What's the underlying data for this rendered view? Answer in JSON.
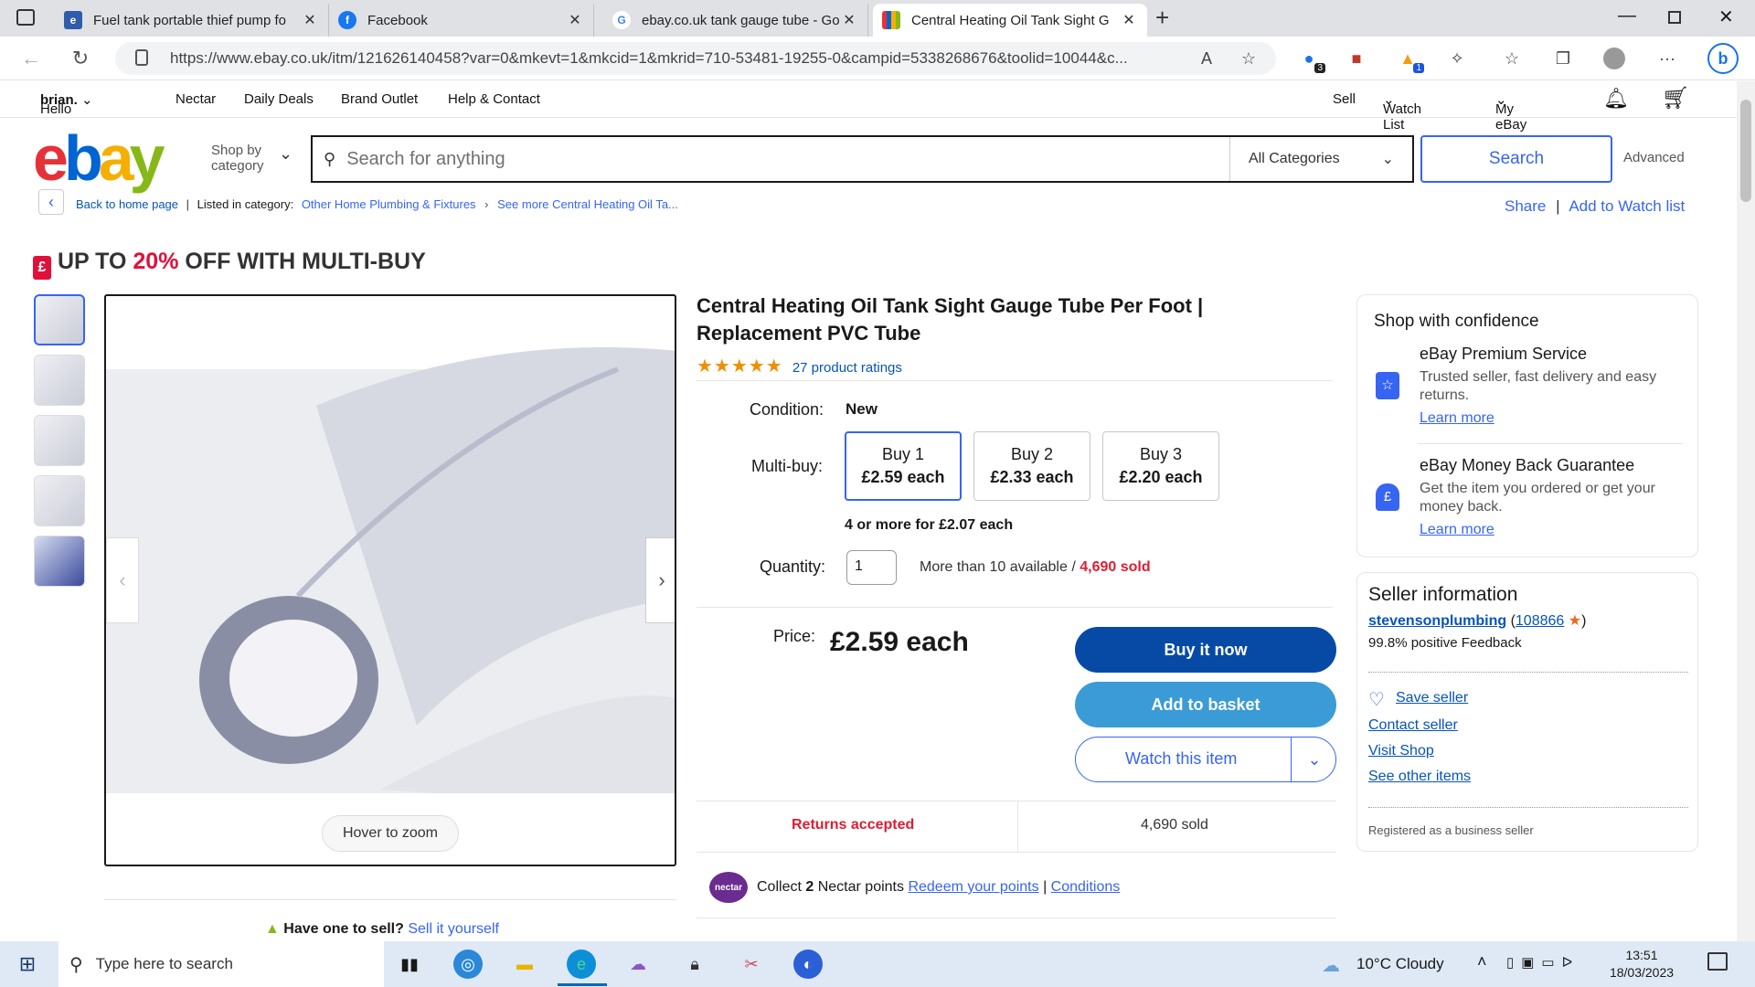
{
  "browser": {
    "tabs": [
      {
        "title": "Fuel tank portable thief pump fo",
        "icon": "ebay-favicon"
      },
      {
        "title": "Facebook",
        "icon": "facebook-favicon"
      },
      {
        "title": "ebay.co.uk tank gauge tube - Go",
        "icon": "google-favicon"
      },
      {
        "title": "Central Heating Oil Tank Sight G",
        "icon": "ebay-favicon"
      }
    ],
    "url": "https://www.ebay.co.uk/itm/121626140458?var=0&mkevt=1&mkcid=1&mkrid=710-53481-19255-0&campid=5338268676&toolid=10044&c...",
    "url_domain": "www.ebay.co.uk",
    "ext_badge_1": "3",
    "ext_badge_2": "1"
  },
  "nav": {
    "greeting": "Hello",
    "user": "brian.",
    "items": [
      "Nectar",
      "Daily Deals",
      "Brand Outlet",
      "Help & Contact"
    ],
    "sell": "Sell",
    "watchlist": "Watch List",
    "myebay": "My eBay"
  },
  "search": {
    "shop_by_1": "Shop by",
    "shop_by_2": "category",
    "placeholder": "Search for anything",
    "category": "All Categories",
    "button": "Search",
    "advanced": "Advanced"
  },
  "breadcrumb": {
    "back": "Back to home page",
    "listed_in": "Listed in category:",
    "cat1": "Other Home Plumbing & Fixtures",
    "cat2": "See more Central Heating Oil Ta...",
    "share": "Share",
    "add_watch": "Add to Watch list"
  },
  "promo": {
    "pre": "UP TO",
    "pct": "20%",
    "post": "OFF WITH MULTI-BUY"
  },
  "gallery": {
    "hover_zoom": "Hover to zoom"
  },
  "product": {
    "title_1": "Central Heating Oil Tank Sight Gauge Tube Per Foot |",
    "title_2": "Replacement PVC Tube",
    "ratings": "27 product ratings",
    "stars": 5,
    "condition_label": "Condition:",
    "condition": "New",
    "multibuy_label": "Multi-buy:",
    "multibuy": [
      {
        "qty": "Buy 1",
        "price": "£2.59 each"
      },
      {
        "qty": "Buy 2",
        "price": "£2.33 each"
      },
      {
        "qty": "Buy 3",
        "price": "£2.20 each"
      }
    ],
    "more_for": "4 or more for £2.07 each",
    "quantity_label": "Quantity:",
    "quantity": "1",
    "available": "More than 10 available /",
    "sold": "4,690 sold",
    "price_label": "Price:",
    "price": "£2.59 each",
    "buy_now": "Buy it now",
    "add_basket": "Add to basket",
    "watch": "Watch this item",
    "returns": "Returns accepted",
    "sold_count": "4,690 sold",
    "nectar_badge": "nectar",
    "nectar_pre": "Collect",
    "nectar_points": "2",
    "nectar_post": "Nectar points",
    "redeem": "Redeem your points",
    "conditions": "Conditions",
    "have_one": "Have one to sell?",
    "sell_it": "Sell it yourself"
  },
  "confidence": {
    "title": "Shop with confidence",
    "premium_title": "eBay Premium Service",
    "premium_text": "Trusted seller, fast delivery and easy returns.",
    "learn1": "Learn more",
    "mbg_title": "eBay Money Back Guarantee",
    "mbg_text": "Get the item you ordered or get your money back.",
    "learn2": "Learn more"
  },
  "seller": {
    "title": "Seller information",
    "name": "stevensonplumbing",
    "score": "108866",
    "feedback": "99.8% positive Feedback",
    "save": "Save seller",
    "contact": "Contact seller",
    "visit": "Visit Shop",
    "other": "See other items",
    "registered": "Registered as a business seller"
  },
  "taskbar": {
    "search": "Type here to search",
    "weather": "10°C  Cloudy",
    "time": "13:51",
    "date": "18/03/2023"
  },
  "colors": {
    "ebay_red": "#e53238",
    "ebay_blue": "#0064d2",
    "ebay_yellow": "#f5af02",
    "ebay_green": "#86b817",
    "primary_btn": "#064aa6",
    "secondary_btn": "#3b9bd6",
    "sold_red": "#dd1e31"
  }
}
